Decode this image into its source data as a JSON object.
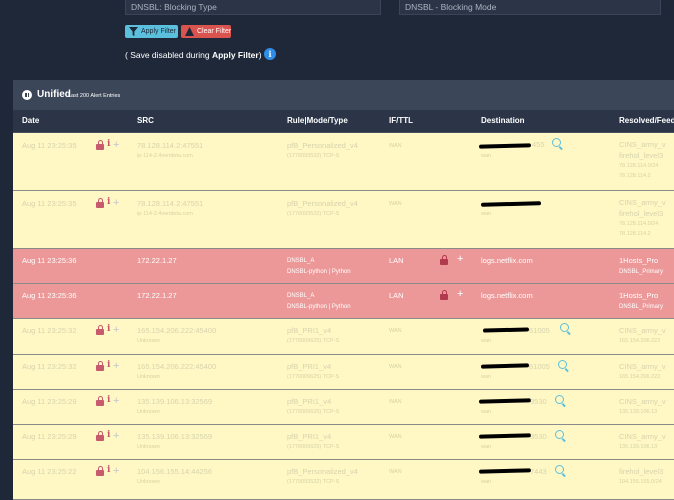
{
  "filter": {
    "blocking_type_placeholder": "DNSBL: Blocking Type",
    "blocking_mode_placeholder": "DNSBL - Blocking Mode",
    "apply_label": "Apply Filter",
    "clear_label": "Clear Filter",
    "save_note_prefix": "( Save disabled during ",
    "save_note_bold": "Apply Filter",
    "save_note_suffix": ")"
  },
  "panel": {
    "title": "Unified",
    "subtitle": "Last 200 Alert Entries",
    "columns": [
      "Date",
      "SRC",
      "Rule|Mode/Type",
      "IF/TTL",
      "Destination",
      "Resolved/Feed"
    ]
  },
  "rows": [
    {
      "date": "Aug 11 23:25:35",
      "src": "78.128.114.2:47551",
      "src_sub": "ip-114-2.4vendeta.com",
      "rule": "pfB_Personalized_v4",
      "rule_sub": "(1770093532)    TCP-S",
      "if": "WAN",
      "dst": "455",
      "dst_sub": "wan",
      "res": "CINS_army_v",
      "res2": "firehol_level3",
      "res3": "78.128.114.0/24",
      "res4": "78.128.114.2"
    },
    {
      "date": "Aug 11 23:25:35",
      "src": "78.128.114.2:47551",
      "src_sub": "ip-114-2.4vendeta.com",
      "rule": "pfB_Personalized_v4",
      "rule_sub": "(1770093532)    TCP-S",
      "if": "WAN",
      "dst": "",
      "dst_sub": "wan",
      "res": "CINS_army_v",
      "res2": "firehol_level3",
      "res3": "78.128.114.0/24",
      "res4": "78.128.114.2"
    },
    {
      "date": "Aug 11 23:25:36",
      "src": "172.22.1.27",
      "src_sub": "",
      "rule": "DNSBL_A",
      "rule_sub": "DNSBL-python | Python",
      "if": "LAN",
      "dst": "logs.netflix.com",
      "dst_sub": "",
      "res": "1Hosts_Pro",
      "res2": "DNSBL_Primary",
      "res3": "",
      "res4": ""
    },
    {
      "date": "Aug 11 23:25:36",
      "src": "172.22.1.27",
      "src_sub": "",
      "rule": "DNSBL_A",
      "rule_sub": "DNSBL-python | Python",
      "if": "LAN",
      "dst": "logs.netflix.com",
      "dst_sub": "",
      "res": "1Hosts_Pro",
      "res2": "DNSBL_Primary",
      "res3": "",
      "res4": ""
    },
    {
      "date": "Aug 11 23:25:32",
      "src": "165.154.206.222:45400",
      "src_sub": "Unknown",
      "rule": "pfB_PRI1_v4",
      "rule_sub": "(1770009625)    TCP-S",
      "if": "WAN",
      "dst": "61005",
      "dst_sub": "wan",
      "res": "CINS_army_v",
      "res2": "165.154.206.222",
      "res3": "",
      "res4": ""
    },
    {
      "date": "Aug 11 23:25:32",
      "src": "165.154.206.222:45400",
      "src_sub": "Unknown",
      "rule": "pfB_PRI1_v4",
      "rule_sub": "(1770009625)    TCP-S",
      "if": "WAN",
      "dst": "61005",
      "dst_sub": "wan",
      "res": "CINS_army_v",
      "res2": "165.154.206.222",
      "res3": "",
      "res4": ""
    },
    {
      "date": "Aug 11 23:25:29",
      "src": "135.139.106.13:32569",
      "src_sub": "Unknown",
      "rule": "pfB_PRI1_v4",
      "rule_sub": "(1770009625)    TCP-S",
      "if": "WAN",
      "dst": "3530",
      "dst_sub": "wan",
      "res": "CINS_army_v",
      "res2": "135.139.106.13",
      "res3": "",
      "res4": ""
    },
    {
      "date": "Aug 11 23:25:29",
      "src": "135.139.106.13:32569",
      "src_sub": "Unknown",
      "rule": "pfB_PRI1_v4",
      "rule_sub": "(1770009625)    TCP-S",
      "if": "WAN",
      "dst": "3530",
      "dst_sub": "wan",
      "res": "CINS_army_v",
      "res2": "135.139.106.13",
      "res3": "",
      "res4": ""
    },
    {
      "date": "Aug 11 23:25:22",
      "src": "104.156.155.14:44256",
      "src_sub": "Unknown",
      "rule": "pfB_Personalized_v4",
      "rule_sub": "(1770093532)    TCP-S",
      "if": "WAN",
      "dst": "7443",
      "dst_sub": "wan",
      "res": "firehol_level3",
      "res2": "104.156.155.0/24",
      "res3": "",
      "res4": ""
    }
  ]
}
